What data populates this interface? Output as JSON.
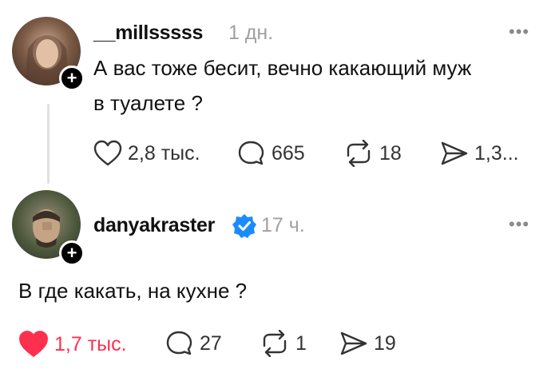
{
  "post": {
    "username": "__millsssss",
    "time": "1 дн.",
    "text_line1": "А вас тоже бесит, вечно какающий муж",
    "text_line2": "в туалете ?",
    "likes": "2,8 тыс.",
    "comments": "665",
    "reposts": "18",
    "shares": "1,3..."
  },
  "reply": {
    "username": "danyakraster",
    "time": "17 ч.",
    "text": "В где какать, на кухне ?",
    "likes": "1,7 тыс.",
    "comments": "27",
    "reposts": "1",
    "shares": "19"
  },
  "colors": {
    "liked": "#ff2f4e",
    "verified": "#1a8cff",
    "muted": "#a0a0a0"
  },
  "icons": [
    "plus-icon",
    "more-icon",
    "heart-icon",
    "comment-icon",
    "repost-icon",
    "share-icon",
    "verified-badge-icon"
  ]
}
